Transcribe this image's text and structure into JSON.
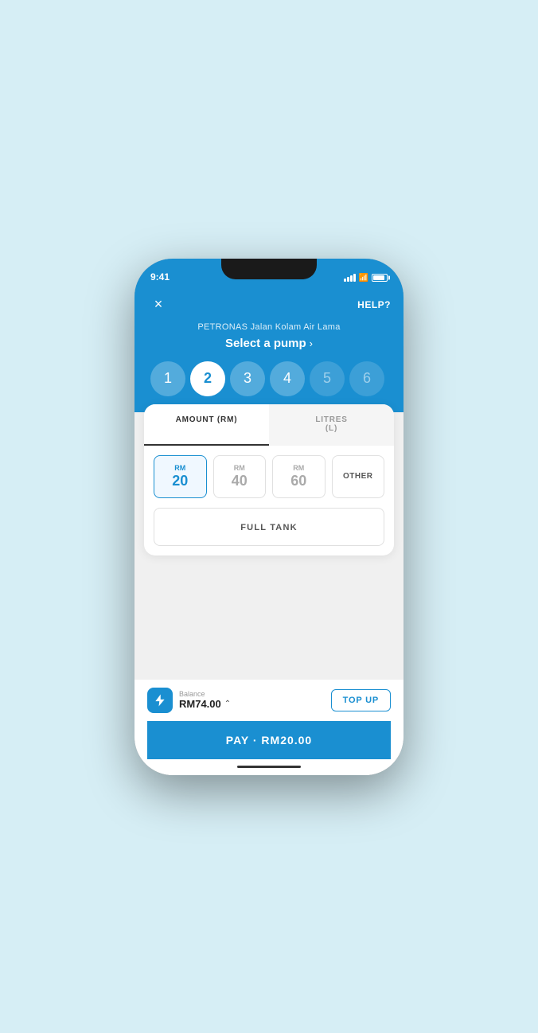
{
  "status_bar": {
    "time": "9:41"
  },
  "header": {
    "close_label": "×",
    "help_label": "HELP?",
    "station_name": "PETRONAS Jalan Kolam Air Lama",
    "select_pump_label": "Select a pump"
  },
  "pumps": [
    {
      "number": "1",
      "state": "normal"
    },
    {
      "number": "2",
      "state": "active"
    },
    {
      "number": "3",
      "state": "normal"
    },
    {
      "number": "4",
      "state": "normal"
    },
    {
      "number": "5",
      "state": "faded"
    },
    {
      "number": "6",
      "state": "faded"
    }
  ],
  "tabs": [
    {
      "label": "AMOUNT (RM)",
      "state": "active"
    },
    {
      "label": "LITRES\n(L)",
      "state": "inactive"
    }
  ],
  "amounts": [
    {
      "prefix": "RM",
      "value": "20",
      "state": "selected"
    },
    {
      "prefix": "RM",
      "value": "40",
      "state": "normal"
    },
    {
      "prefix": "RM",
      "value": "60",
      "state": "normal"
    }
  ],
  "other_label": "OTHER",
  "full_tank_label": "FULL TANK",
  "balance": {
    "label": "Balance",
    "amount": "RM74.00"
  },
  "topup_label": "TOP UP",
  "pay_label": "PAY · RM20.00"
}
